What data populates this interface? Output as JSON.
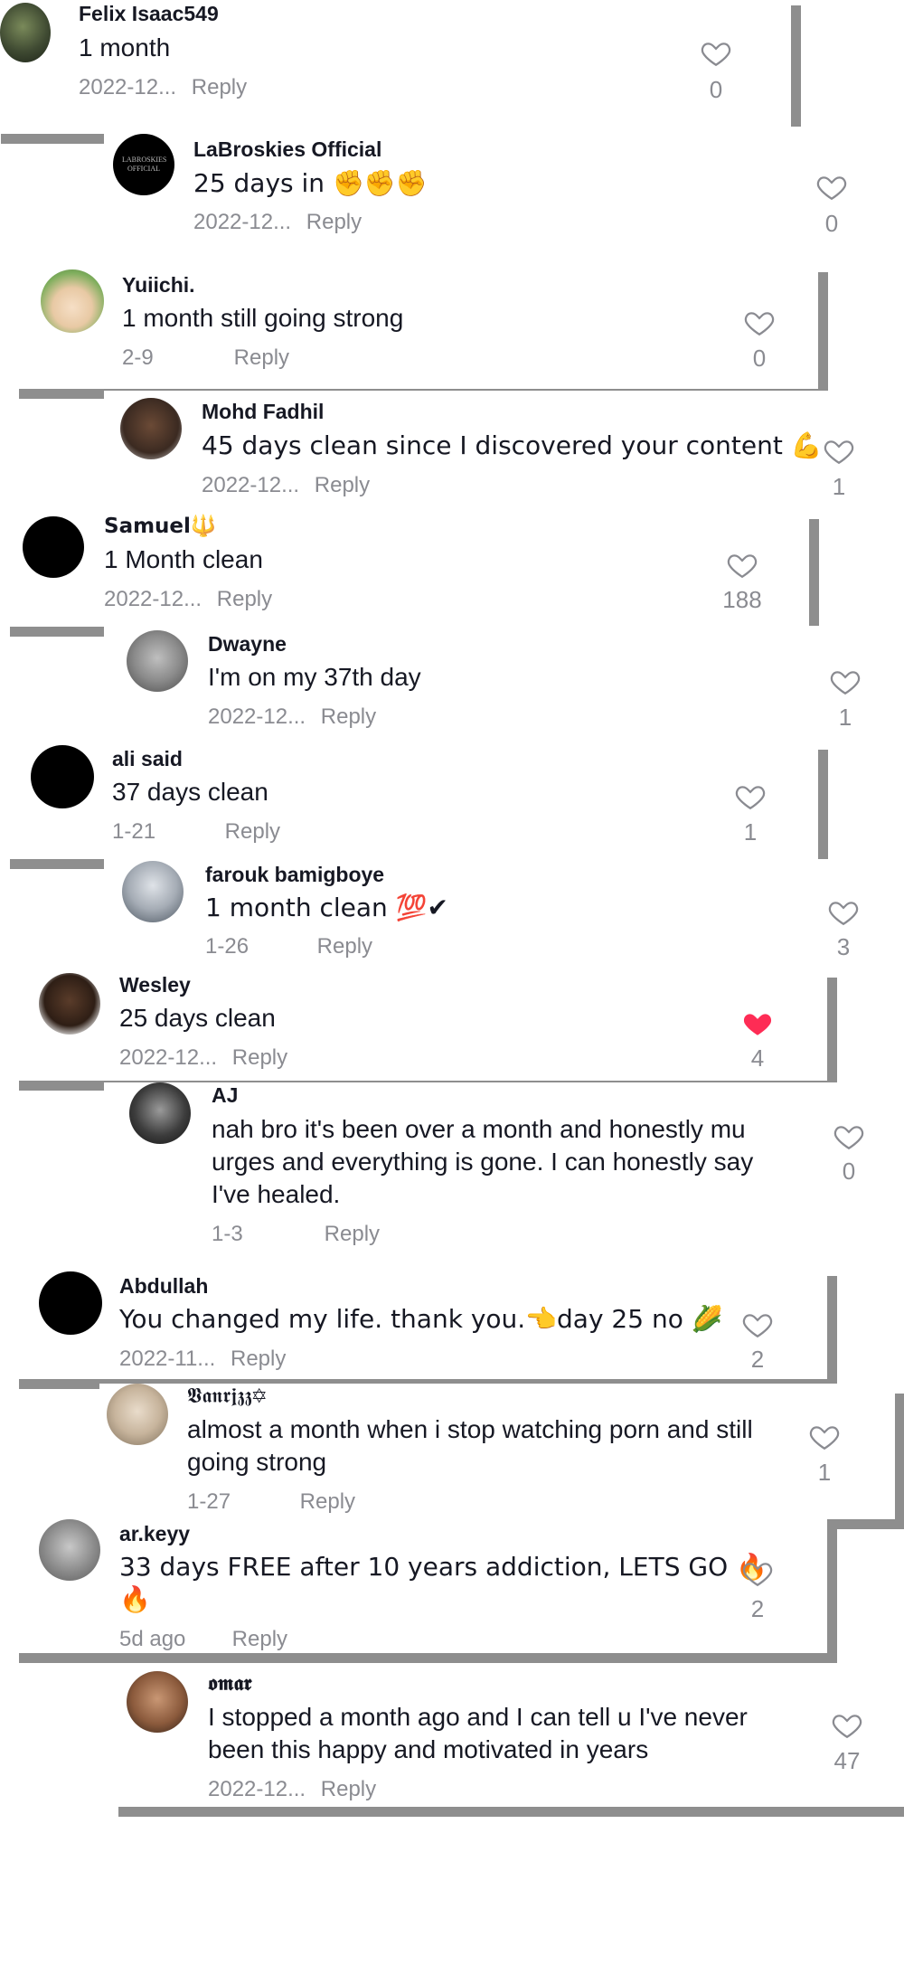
{
  "comments": [
    {
      "user": "Felix Isaac549",
      "text": "1 month",
      "date": "2022-12...",
      "reply": "Reply",
      "likes": "0",
      "liked": false
    },
    {
      "user": "LaBroskies Official",
      "text": "25 days in ✊✊✊",
      "date": "2022-12...",
      "reply": "Reply",
      "likes": "0",
      "liked": false,
      "avatar_text": "LABROSKIES OFFICIAL"
    },
    {
      "user": "Yuiichi.",
      "text": "1 month still going strong",
      "date": "2-9",
      "reply": "Reply",
      "likes": "0",
      "liked": false
    },
    {
      "user": "Mohd Fadhil",
      "text": "45 days clean since I discovered your content 💪",
      "date": "2022-12...",
      "reply": "Reply",
      "likes": "1",
      "liked": false
    },
    {
      "user": "Samuel🔱",
      "text": "1 Month clean",
      "date": "2022-12...",
      "reply": "Reply",
      "likes": "188",
      "liked": false
    },
    {
      "user": "Dwayne",
      "text": "I'm on my 37th day",
      "date": "2022-12...",
      "reply": "Reply",
      "likes": "1",
      "liked": false
    },
    {
      "user": "ali said",
      "text": "37 days clean",
      "date": "1-21",
      "reply": "Reply",
      "likes": "1",
      "liked": false
    },
    {
      "user": "farouk bamigboye",
      "text": "1 month clean 💯✔",
      "date": "1-26",
      "reply": "Reply",
      "likes": "3",
      "liked": false
    },
    {
      "user": "Wesley",
      "text": "25 days clean",
      "date": "2022-12...",
      "reply": "Reply",
      "likes": "4",
      "liked": true
    },
    {
      "user": "AJ",
      "text": "nah bro it's been over a month and honestly mu",
      "text2": "urges and everything is gone. I can honestly say",
      "text3": "I've healed.",
      "date": "1-3",
      "reply": "Reply",
      "likes": "0",
      "liked": false
    },
    {
      "user": "Abdullah",
      "text": "You changed my life. thank you.👈day 25 no 🌽",
      "date": "2022-11...",
      "reply": "Reply",
      "likes": "2",
      "liked": false
    },
    {
      "user": "𝖁𝖆𝖓𝖗𝖏𝖟𝖟✡",
      "text": "almost a month when i stop watching porn and still",
      "text2": "going strong",
      "date": "1-27",
      "reply": "Reply",
      "likes": "1",
      "liked": false
    },
    {
      "user": "ar.keyy",
      "text": "33 days FREE after 10 years addiction, LETS GO 🔥",
      "text2": "🔥",
      "date": "5d ago",
      "reply": "Reply",
      "likes": "2",
      "liked": false
    },
    {
      "user": "𝖔𝖒𝖆𝖗",
      "text": "I stopped a month ago and I can tell u I've never",
      "text2": "been this happy and motivated in years",
      "date": "2022-12...",
      "reply": "Reply",
      "likes": "47",
      "liked": false
    }
  ],
  "colors": {
    "liked_heart": "#fe2c55",
    "meta": "#8a8b91",
    "text": "#161823",
    "shadow": "#8e8e8e"
  }
}
